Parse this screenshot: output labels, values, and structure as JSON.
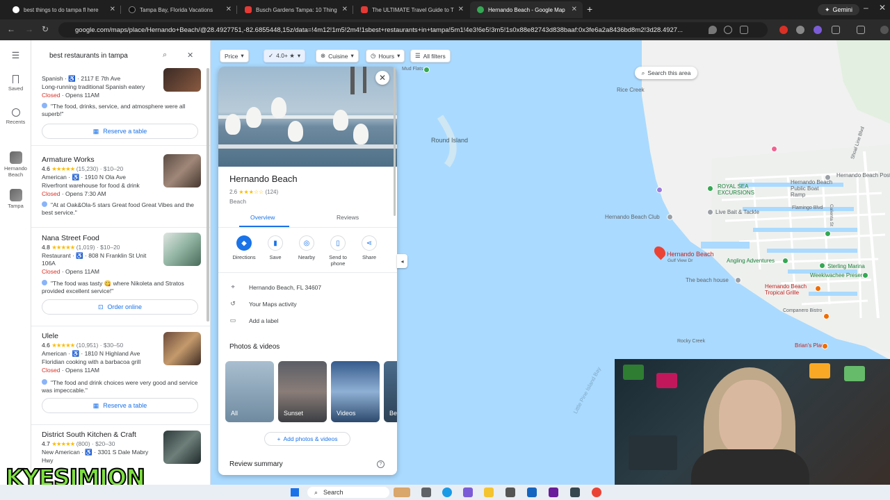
{
  "browser": {
    "tabs": [
      {
        "title": "best things to do tampa fl here",
        "active": false
      },
      {
        "title": "Tampa Bay, Florida Vacations",
        "active": false
      },
      {
        "title": "Busch Gardens Tampa: 10 Thing",
        "active": false
      },
      {
        "title": "The ULTIMATE Travel Guide to T",
        "active": false
      },
      {
        "title": "Hernando Beach - Google Map",
        "active": true
      }
    ],
    "gemini_label": "Gemini",
    "url": "google.com/maps/place/Hernando+Beach/@28.4927751,-82.6855448,15z/data=!4m12!1m5!2m4!1sbest+restaurants+in+tampa!5m1!4e3!6e5!3m5!1s0x88e82743d838baaf:0x3fe6a2a8436bd8m2!3d28.4927..."
  },
  "rail": {
    "menu_icon": "hamburger-icon",
    "items": [
      {
        "label": "Saved",
        "icon": "bookmark-icon"
      },
      {
        "label": "Recents",
        "icon": "history-icon"
      },
      {
        "label": "Hernando Beach",
        "icon": "place-thumb"
      },
      {
        "label": "Tampa",
        "icon": "place-thumb"
      }
    ]
  },
  "search": {
    "value": "best restaurants in tampa"
  },
  "results": [
    {
      "partial_top": "Spanish · ♿ · 2117 E 7th Ave",
      "description": "Long-running traditional Spanish eatery",
      "status_closed": "Closed",
      "status_opens": " · Opens 11AM",
      "quote": "\"The food, drinks, service, and atmosphere were all superb!\"",
      "button": "Reserve a table"
    },
    {
      "name": "Armature Works",
      "rating": "4.6",
      "stars": "★★★★★",
      "meta": "(15,230) · $10–20",
      "line1": "American · ♿ · 1910 N Ola Ave",
      "line2": "Riverfront warehouse for food & drink",
      "status_closed": "Closed",
      "status_opens": " · Opens 7:30 AM",
      "quote": "\"At at Oak&Ola-5 stars Great food Great Vibes and the best service.\""
    },
    {
      "name": "Nana Street Food",
      "rating": "4.8",
      "stars": "★★★★★",
      "meta": "(1,019) · $10–20",
      "line1": "Restaurant · ♿ · 808 N Franklin St Unit",
      "line1b": "106A",
      "status_closed": "Closed",
      "status_opens": " · Opens 11AM",
      "quote": "\"The food was tasty 😋 where Nikoleta and Stratos provided excellent service!\"",
      "button": "Order online"
    },
    {
      "name": "Ulele",
      "rating": "4.6",
      "stars": "★★★★★",
      "meta": "(10,951) · $30–50",
      "line1": "American · ♿ · 1810 N Highland Ave",
      "line2": "Floridian cooking with a barbacoa grill",
      "status_closed": "Closed",
      "status_opens": " · Opens 11AM",
      "quote": "\"The food and drink choices were very good and service was impeccable.\"",
      "button": "Reserve a table"
    },
    {
      "name": "District South Kitchen & Craft",
      "rating": "4.7",
      "stars": "★★★★★",
      "meta": "(800) · $20–30",
      "line1": "New American · ♿ · 3301 S Dale Mabry",
      "line1b": "Hwy"
    }
  ],
  "filters": [
    {
      "label": "Price",
      "selected": false
    },
    {
      "label": "4.0+ ★",
      "selected": true
    },
    {
      "label": "Cuisine",
      "selected": false
    },
    {
      "label": "Hours",
      "selected": false
    },
    {
      "label": "All filters",
      "selected": false
    }
  ],
  "place": {
    "title": "Hernando Beach",
    "rating": "2.6",
    "stars": "★★★☆☆",
    "review_count": "(124)",
    "type": "Beach",
    "tabs": [
      {
        "label": "Overview",
        "active": true
      },
      {
        "label": "Reviews",
        "active": false
      }
    ],
    "actions": [
      {
        "label": "Directions",
        "icon": "directions-icon"
      },
      {
        "label": "Save",
        "icon": "bookmark-icon"
      },
      {
        "label": "Nearby",
        "icon": "nearby-icon"
      },
      {
        "label": "Send to phone",
        "icon": "phone-icon"
      },
      {
        "label": "Share",
        "icon": "share-icon"
      }
    ],
    "address": "Hernando Beach, FL 34607",
    "activity": "Your Maps activity",
    "add_label": "Add a label",
    "photos_heading": "Photos & videos",
    "photos": [
      {
        "label": "All"
      },
      {
        "label": "Sunset"
      },
      {
        "label": "Videos"
      },
      {
        "label": "Be"
      }
    ],
    "add_photos": "Add photos & videos",
    "review_summary": "Review summary"
  },
  "map": {
    "search_area": "Search this area",
    "labels": [
      {
        "text": "Round Island"
      },
      {
        "text": "Rice Creek"
      },
      {
        "text": "Hernando Beach Post Office"
      },
      {
        "text": "Hernando Beach Public Boat Ramp"
      },
      {
        "text": "ROYAL SEA EXCURSIONS"
      },
      {
        "text": "Live Bait & Tackle"
      },
      {
        "text": "Flamingo Blvd"
      },
      {
        "text": "Hernando Beach Club"
      },
      {
        "text": "Hernando Beach"
      },
      {
        "text": "Gulf View Dr"
      },
      {
        "text": "Angling Adventures"
      },
      {
        "text": "Sterling Marina"
      },
      {
        "text": "Weekiwachee Preserve"
      },
      {
        "text": "The beach house"
      },
      {
        "text": "Hernando Beach Tropical Grille"
      },
      {
        "text": "Companero Bistro"
      },
      {
        "text": "Rocky Creek"
      },
      {
        "text": "Brian's Place"
      },
      {
        "text": "Little Pine Island Bay"
      },
      {
        "text": "Shoal Line Blvd"
      },
      {
        "text": "Calienta St"
      },
      {
        "text": "Mud Flats"
      }
    ]
  },
  "watermark": "KYESIMJON",
  "taskbar": {
    "search_label": "Search"
  },
  "colors": {
    "accent": "#1a73e8",
    "water": "#aadaff",
    "closed": "#d93025",
    "stars": "#fbbc04"
  }
}
